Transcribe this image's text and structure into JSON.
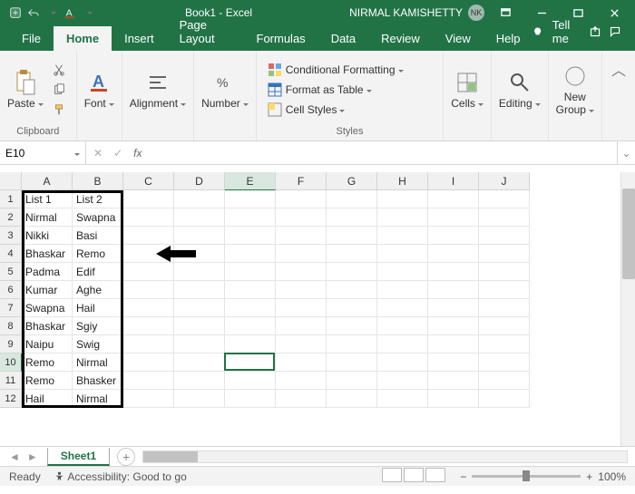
{
  "title": {
    "doc": "Book1 - Excel",
    "user": "NIRMAL KAMISHETTY",
    "initials": "NK"
  },
  "tabs": {
    "file": "File",
    "home": "Home",
    "insert": "Insert",
    "pageLayout": "Page Layout",
    "formulas": "Formulas",
    "data": "Data",
    "review": "Review",
    "view": "View",
    "help": "Help",
    "tellme": "Tell me"
  },
  "ribbon": {
    "clipboard": {
      "label": "Clipboard",
      "paste": "Paste"
    },
    "font": {
      "label": "Font"
    },
    "alignment": {
      "label": "Alignment"
    },
    "number": {
      "label": "Number"
    },
    "styles": {
      "label": "Styles",
      "cond": "Conditional Formatting",
      "table": "Format as Table",
      "cell": "Cell Styles"
    },
    "cells": {
      "label": "Cells"
    },
    "editing": {
      "label": "Editing"
    },
    "newgroup": {
      "label": "New\nGroup"
    }
  },
  "namebox": "E10",
  "cols": [
    "A",
    "B",
    "C",
    "D",
    "E",
    "F",
    "G",
    "H",
    "I",
    "J"
  ],
  "rows": [
    "1",
    "2",
    "3",
    "4",
    "5",
    "6",
    "7",
    "8",
    "9",
    "10",
    "11",
    "12"
  ],
  "cells": [
    [
      "List 1",
      "List 2",
      "",
      "",
      "",
      "",
      "",
      "",
      "",
      ""
    ],
    [
      "Nirmal",
      "Swapna",
      "",
      "",
      "",
      "",
      "",
      "",
      "",
      ""
    ],
    [
      "Nikki",
      "Basi",
      "",
      "",
      "",
      "",
      "",
      "",
      "",
      ""
    ],
    [
      "Bhaskar",
      "Remo",
      "",
      "",
      "",
      "",
      "",
      "",
      "",
      ""
    ],
    [
      "Padma",
      "Edif",
      "",
      "",
      "",
      "",
      "",
      "",
      "",
      ""
    ],
    [
      "Kumar",
      "Aghe",
      "",
      "",
      "",
      "",
      "",
      "",
      "",
      ""
    ],
    [
      "Swapna",
      "Hail",
      "",
      "",
      "",
      "",
      "",
      "",
      "",
      ""
    ],
    [
      "Bhaskar",
      "Sgiy",
      "",
      "",
      "",
      "",
      "",
      "",
      "",
      ""
    ],
    [
      "Naipu",
      "Swig",
      "",
      "",
      "",
      "",
      "",
      "",
      "",
      ""
    ],
    [
      "Remo",
      "Nirmal",
      "",
      "",
      "",
      "",
      "",
      "",
      "",
      ""
    ],
    [
      "Remo",
      "Bhasker",
      "",
      "",
      "",
      "",
      "",
      "",
      "",
      ""
    ],
    [
      "Hail",
      "Nirmal",
      "",
      "",
      "",
      "",
      "",
      "",
      "",
      ""
    ]
  ],
  "activeCell": {
    "row": 10,
    "col": 5
  },
  "chart_data": null,
  "sheet": {
    "name": "Sheet1"
  },
  "status": {
    "ready": "Ready",
    "access": "Accessibility: Good to go",
    "zoom": "100%"
  }
}
